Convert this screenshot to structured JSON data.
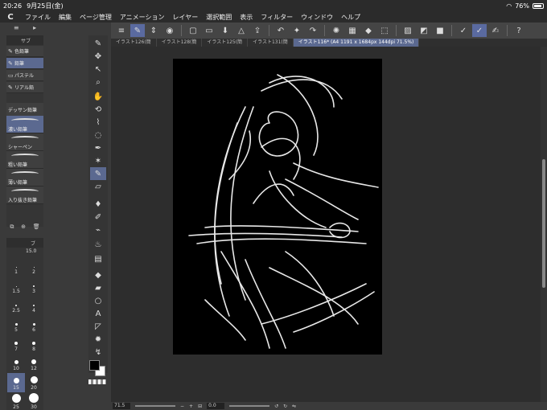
{
  "status": {
    "time": "20:26",
    "date": "9月25日(金)",
    "battery": "76%"
  },
  "menu": {
    "logo": "C",
    "items": [
      "ファイル",
      "編集",
      "ページ管理",
      "アニメーション",
      "レイヤー",
      "選択範囲",
      "表示",
      "フィルター",
      "ウィンドウ",
      "ヘルプ"
    ]
  },
  "subtool": {
    "header": "サブ",
    "groups": [
      "色鉛筆",
      "鉛筆",
      "パステル",
      "リアル鉛"
    ],
    "brushes": [
      "デッサン鉛筆",
      "濃い鉛筆",
      "シャーペン",
      "粗い鉛筆",
      "薄い鉛筆",
      "入り抜き鉛筆"
    ]
  },
  "brushsize": {
    "header": "ブ",
    "value": "15.0",
    "sizes": [
      "1",
      "2",
      "1.5",
      "3",
      "2.5",
      "4",
      "5",
      "6",
      "7",
      "8",
      "10",
      "12",
      "15",
      "20",
      "25",
      "30"
    ]
  },
  "tabs": [
    "イラスト126(簡",
    "イラスト128(簡",
    "イラスト125(簡",
    "イラスト131(簡",
    "イラスト116* (A4 1191 x 1684px 144dpi 71.5%)"
  ],
  "zoom": "71.5",
  "angle": "0.0",
  "colors": {
    "accent": "#5b6990",
    "canvas": "#000000",
    "bg": "#2d2d2d"
  }
}
